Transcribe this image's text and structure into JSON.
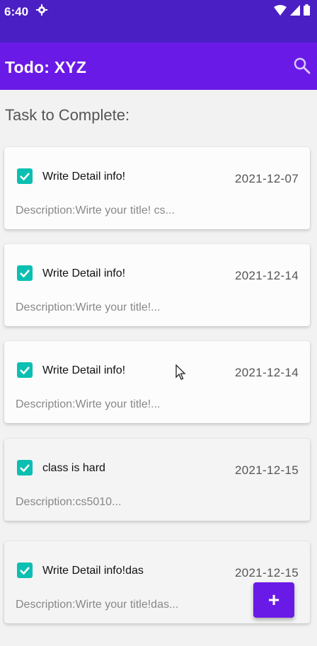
{
  "status_bar": {
    "time": "6:40",
    "icons": [
      "gear-icon",
      "wifi-icon",
      "signal-icon",
      "battery-icon"
    ]
  },
  "app_bar": {
    "title": "Todo: XYZ",
    "search_icon": "search-icon"
  },
  "section_title": "Task to Complete:",
  "tasks": [
    {
      "checked": true,
      "title": "Write Detail info!",
      "date": "2021-12-07",
      "description": "Description:Wirte your title! cs..."
    },
    {
      "checked": true,
      "title": "Write Detail info!",
      "date": "2021-12-14",
      "description": "Description:Wirte your title!..."
    },
    {
      "checked": true,
      "title": "Write Detail info!",
      "date": "2021-12-14",
      "description": "Description:Wirte your title!..."
    },
    {
      "checked": true,
      "title": "class is hard",
      "date": "2021-12-15",
      "description": "Description:cs5010..."
    },
    {
      "checked": true,
      "title": "Write Detail info!das",
      "date": "2021-12-15",
      "description": "Description:Wirte your title!das..."
    }
  ],
  "fab": {
    "label": "+",
    "icon": "add-icon"
  },
  "colors": {
    "status_bar": "#4a1fc4",
    "app_bar": "#6a1ae6",
    "checkbox": "#0bbfb2",
    "fab": "#6a1ae6"
  }
}
